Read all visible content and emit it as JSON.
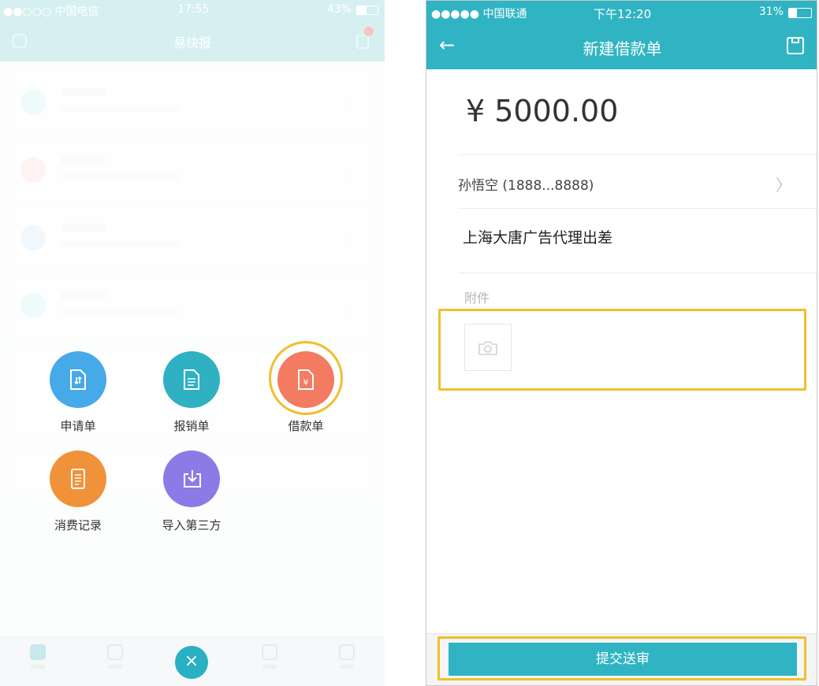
{
  "left": {
    "status": {
      "carrier": "●●○○○ 中国电信 ",
      "time": "17:55",
      "battery": "43%"
    },
    "nav": {
      "title": "易快报"
    },
    "actions": [
      {
        "label": "申请单",
        "color": "#46a9e8",
        "icon": "document-transfer-icon"
      },
      {
        "label": "报销单",
        "color": "#2fb1c3",
        "icon": "document-lines-icon"
      },
      {
        "label": "借款单",
        "color": "#f27b62",
        "icon": "document-yen-icon"
      },
      {
        "label": "消费记录",
        "color": "#f0923a",
        "icon": "receipt-icon"
      },
      {
        "label": "导入第三方",
        "color": "#8c7ae6",
        "icon": "import-tray-icon"
      }
    ],
    "close_label": "×"
  },
  "right": {
    "status": {
      "carrier": "●●●●● 中国联通 ",
      "time": "下午12:20",
      "battery": "31%"
    },
    "nav": {
      "title": "新建借款单",
      "back": "←"
    },
    "amount": "¥ 5000.00",
    "payee": "孙悟空 (1888...8888)",
    "purpose": "上海大唐广告代理出差",
    "attachment_label": "附件",
    "submit_label": "提交送审"
  },
  "colors": {
    "accent": "#30b4c3",
    "highlight": "#f2be2a",
    "loan": "#f27b62"
  }
}
